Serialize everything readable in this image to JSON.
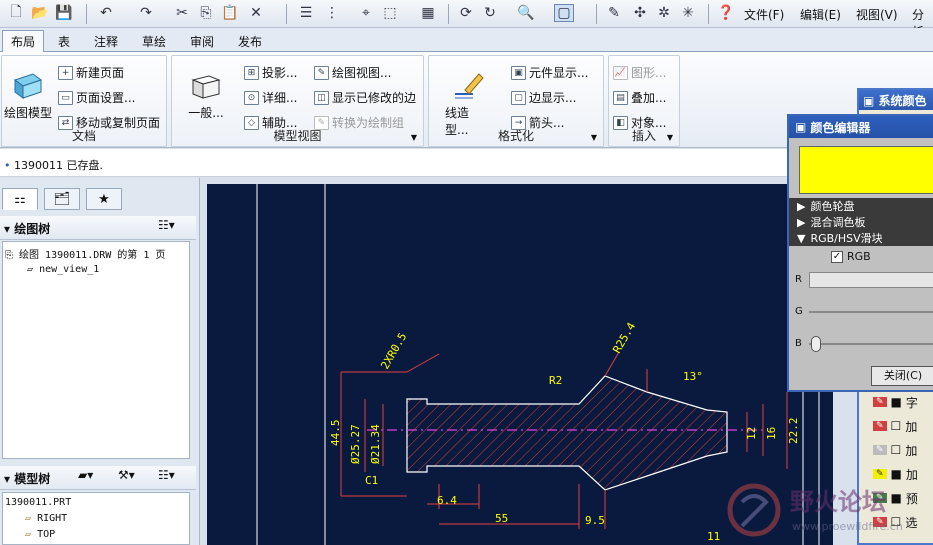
{
  "menus": [
    "文件(F)",
    "编辑(E)",
    "视图(V)",
    "分析"
  ],
  "tabs": [
    "布局",
    "表",
    "注释",
    "草绘",
    "审阅",
    "发布"
  ],
  "active_tab": "布局",
  "ribbon": {
    "doc_group": {
      "label": "文档",
      "big_button": "绘图模型",
      "items": [
        "新建页面",
        "页面设置...",
        "移动或复制页面"
      ]
    },
    "model_view_group": {
      "label": "模型视图",
      "big_button": "一般...",
      "col1": [
        "投影...",
        "详细...",
        "辅助..."
      ],
      "col2": [
        "绘图视图...",
        "显示已修改的边",
        "转换为绘制组"
      ]
    },
    "format_group": {
      "label": "格式化",
      "big_button": "线造型...",
      "items": [
        "元件显示...",
        "边显示...",
        "箭头..."
      ]
    },
    "insert_group": {
      "label": "插入",
      "items": [
        "图形...",
        "叠加...",
        "对象..."
      ]
    }
  },
  "status_message": "1390011 已存盘.",
  "draw_tree": {
    "title": "绘图树",
    "items": [
      "绘图 1390011.DRW 的第 1 页",
      "new_view_1"
    ]
  },
  "model_tree": {
    "title": "模型树",
    "items": [
      "1390011.PRT",
      "RIGHT",
      "TOP"
    ]
  },
  "drawing": {
    "dims": [
      "2XR0.5",
      "R25.4",
      "13°",
      "R2",
      "44.5",
      "Ø25.27",
      "Ø21.34",
      "C1",
      "6.4",
      "55",
      "9.5",
      "12",
      "16",
      "22.2",
      "11"
    ]
  },
  "color_editor": {
    "title": "颜色编辑器",
    "sections": [
      "颜色轮盘",
      "混合调色板",
      "RGB/HSV滑块"
    ],
    "rgb_label": "RGB",
    "sliders": [
      "R",
      "G",
      "B"
    ],
    "close_button": "关闭(C)",
    "swatch_color": "#ffff00"
  },
  "system_color": {
    "title": "系统颜色",
    "rows": [
      "字",
      "加",
      "加",
      "加",
      "预",
      "选"
    ]
  },
  "watermark": "野火论坛",
  "watermark_url": "www.proewildfire.cn"
}
